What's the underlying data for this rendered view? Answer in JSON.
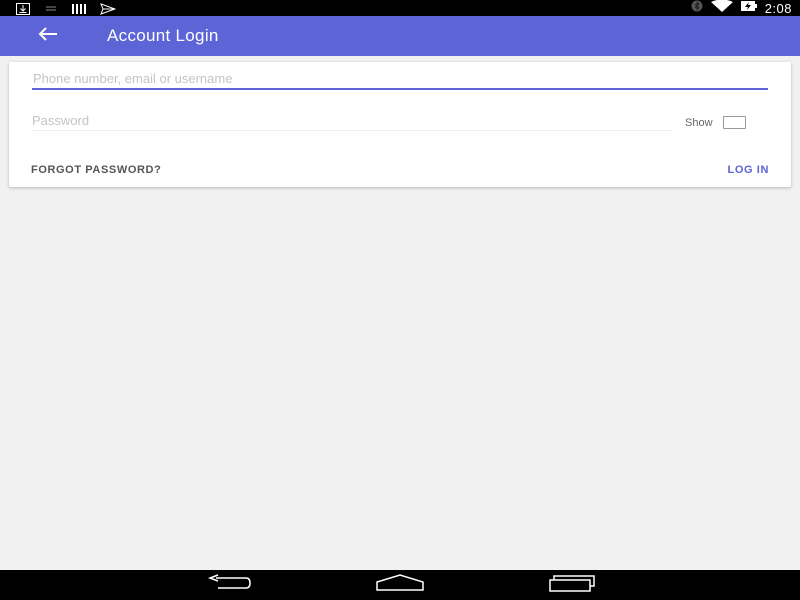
{
  "status_bar": {
    "time": "2:08",
    "left_icons": [
      "download-icon",
      "notification-icon",
      "storage-icon",
      "send-icon"
    ],
    "right_icons": [
      "bluetooth-icon",
      "wifi-icon",
      "battery-charging-icon"
    ]
  },
  "toolbar": {
    "title": "Account Login",
    "back_icon": "arrow-left-icon",
    "color": "#5c64d6"
  },
  "form": {
    "username_placeholder": "Phone number, email or username",
    "username_value": "",
    "password_placeholder": "Password",
    "password_value": "",
    "show_label": "Show",
    "show_checked": false
  },
  "actions": {
    "forgot_password_label": "FORGOT PASSWORD?",
    "login_label": "LOG IN"
  },
  "nav_bar": {
    "icons": [
      "back-nav-icon",
      "home-nav-icon",
      "recents-nav-icon"
    ]
  }
}
